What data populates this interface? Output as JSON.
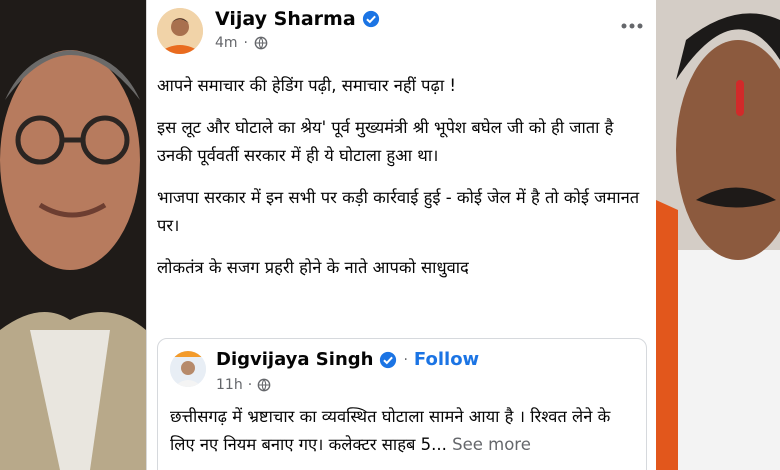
{
  "post": {
    "author": "Vijay Sharma",
    "time": "4m",
    "more_icon": "more-horizontal-icon",
    "paragraphs": [
      "आपने समाचार की हेडिंग पढ़ी, समाचार नहीं पढ़ा !",
      "इस लूट और घोटाले का श्रेय' पूर्व मुख्यमंत्री श्री भूपेश बघेल जी को ही जाता है उनकी पूर्ववर्ती सरकार में ही ये घोटाला हुआ था।",
      "भाजपा सरकार में इन सभी पर कड़ी कार्रवाई हुई - कोई जेल में है तो कोई जमानत पर।",
      "लोकतंत्र के सजग प्रहरी होने के नाते आपको साधुवाद"
    ]
  },
  "shared_post": {
    "author": "Digvijaya Singh",
    "follow_label": "Follow",
    "separator": "·",
    "time": "11h",
    "text": "छत्तीसगढ़ में भ्रष्टाचार का व्यवस्थित घोटाला सामने आया है । रिश्वत लेने के लिए नए नियम बनाए गए। कलेक्टर साहब 5...",
    "see_more_label": "See more"
  },
  "colors": {
    "verified_blue": "#1b74e4",
    "link_blue": "#1b74e4",
    "meta_gray": "#65676b"
  }
}
